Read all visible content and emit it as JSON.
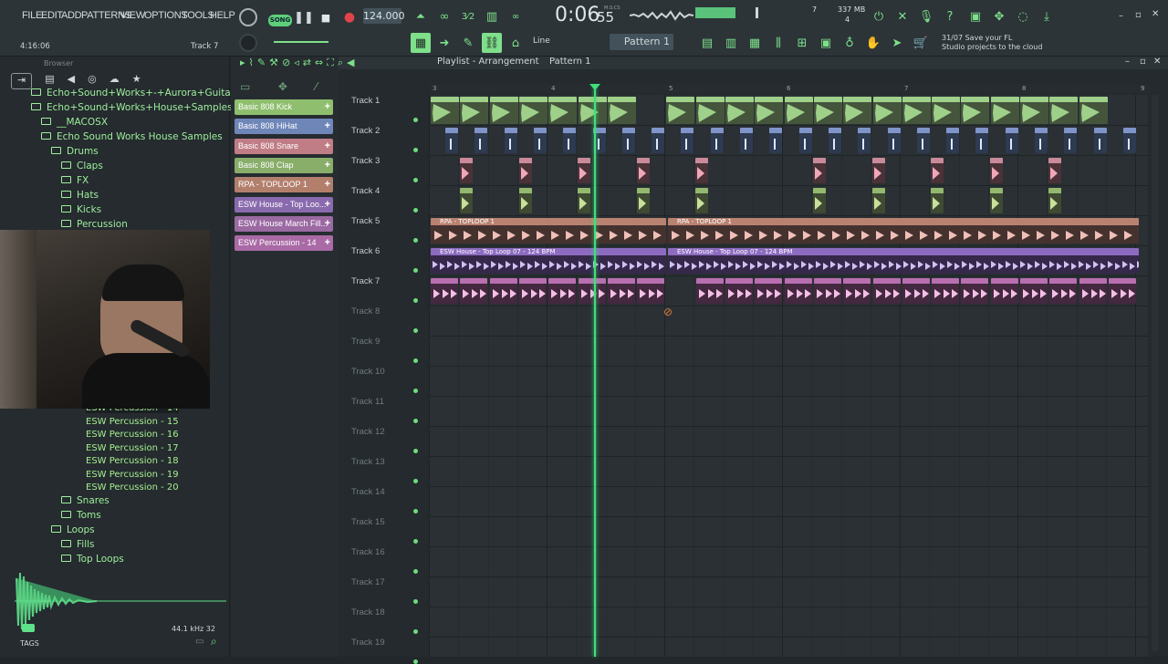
{
  "menu": [
    "FILE",
    "EDIT",
    "ADD",
    "PATTERNS",
    "VIEW",
    "OPTIONS",
    "TOOLS",
    "HELP"
  ],
  "transport": {
    "mode": "SONG",
    "tempo": "124.000",
    "time": "0:06",
    "time_sub": "55",
    "time_label": "M:S:CS",
    "cpu": "7",
    "mem": "337 MB",
    "poly": "4"
  },
  "hint": {
    "time": "4:16:06",
    "track": "Track 7"
  },
  "pattern": {
    "name": "Pattern 1",
    "snap": "Line"
  },
  "news": {
    "line1": "31/07  Save your FL",
    "line2": "Studio projects to the cloud"
  },
  "browser": {
    "title": "Browser",
    "items": [
      {
        "label": "Echo+Sound+Works+-+Aurora+Guitars",
        "indent": 0
      },
      {
        "label": "Echo+Sound+Works+House+Samples",
        "indent": 0
      },
      {
        "label": "__MACOSX",
        "indent": 1
      },
      {
        "label": "Echo Sound Works House Samples",
        "indent": 1
      },
      {
        "label": "Drums",
        "indent": 2
      },
      {
        "label": "Claps",
        "indent": 3
      },
      {
        "label": "FX",
        "indent": 3
      },
      {
        "label": "Hats",
        "indent": 3
      },
      {
        "label": "Kicks",
        "indent": 3
      },
      {
        "label": "Percussion",
        "indent": 3
      }
    ],
    "files": [
      "ESW Percussion - 14",
      "ESW Percussion - 15",
      "ESW Percussion - 16",
      "ESW Percussion - 17",
      "ESW Percussion - 18",
      "ESW Percussion - 19",
      "ESW Percussion - 20"
    ],
    "items2": [
      {
        "label": "Snares",
        "indent": 3
      },
      {
        "label": "Toms",
        "indent": 3
      },
      {
        "label": "Loops",
        "indent": 2
      },
      {
        "label": "Fills",
        "indent": 3
      },
      {
        "label": "Top Loops",
        "indent": 3
      }
    ],
    "sample_rate": "44.1 kHz 32",
    "tags": "TAGS"
  },
  "channels": [
    {
      "label": "Basic 808 Kick",
      "color": "#8fbf6e"
    },
    {
      "label": "Basic 808 HiHat",
      "color": "#6f86b9"
    },
    {
      "label": "Basic 808 Snare",
      "color": "#c07d86"
    },
    {
      "label": "Basic 808 Clap",
      "color": "#88ae6a"
    },
    {
      "label": "RPA - TOPLOOP 1",
      "color": "#b37f6d"
    },
    {
      "label": "ESW House - Top Loo...",
      "color": "#8a6aae"
    },
    {
      "label": "ESW House March Fill...",
      "color": "#9b6aa2"
    },
    {
      "label": "ESW Percussion - 14",
      "color": "#a96aa5"
    }
  ],
  "playlist": {
    "title": "Playlist - Arrangement",
    "pattern": "Pattern 1",
    "bars": [
      "3",
      "4",
      "5",
      "6",
      "7",
      "8",
      "9"
    ],
    "tracks": [
      "Track 1",
      "Track 2",
      "Track 3",
      "Track 4",
      "Track 5",
      "Track 6",
      "Track 7",
      "Track 8",
      "Track 9",
      "Track 10",
      "Track 11",
      "Track 12",
      "Track 13",
      "Track 14",
      "Track 15",
      "Track 16",
      "Track 17",
      "Track 18",
      "Track 19"
    ],
    "clip_labels": {
      "t5": "RPA - TOPLOOP 1",
      "t6": "ESW House - Top Loop 07 - 124 BPM"
    }
  },
  "colors": {
    "accent": "#7ee08a",
    "kick": "#9fd08a",
    "hat": "#7f94c8",
    "snare": "#c98a9a",
    "clap": "#93b86e",
    "toploop": "#b98270",
    "esw": "#8c6bc0",
    "perc": "#b86fb0"
  }
}
